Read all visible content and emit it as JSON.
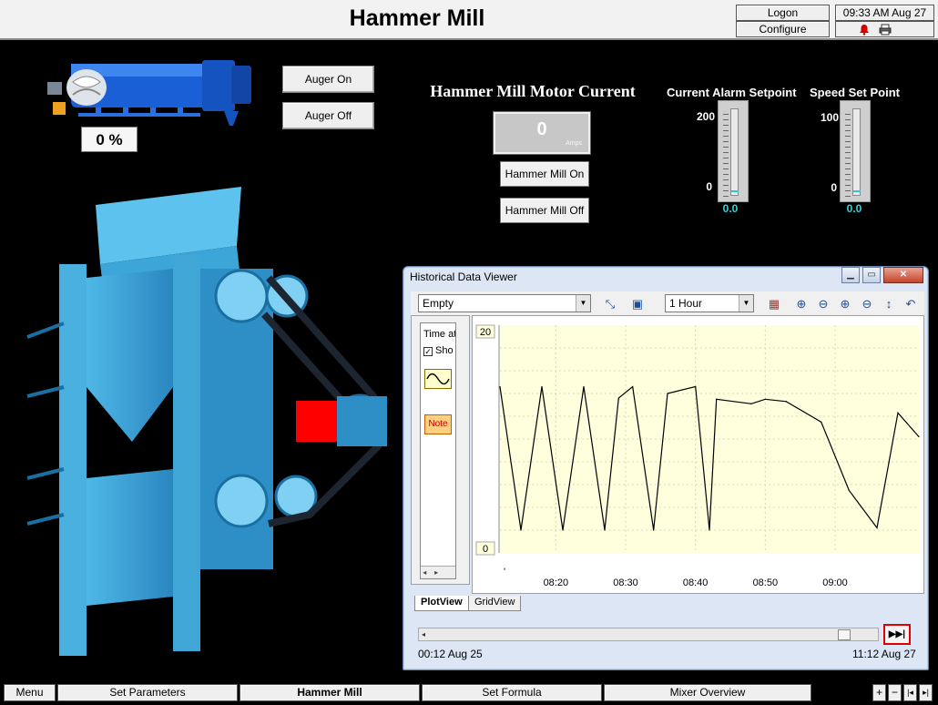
{
  "header": {
    "title": "Hammer Mill",
    "logon_label": "Logon",
    "configure_label": "Configure",
    "datetime": "09:33 AM Aug 27",
    "alarm_icon": "bell-icon",
    "print_icon": "printer-icon"
  },
  "auger": {
    "on_label": "Auger On",
    "off_label": "Auger Off",
    "speed_pct": "0 %"
  },
  "motor": {
    "title": "Hammer Mill Motor Current",
    "value": "0",
    "unit": "Amps",
    "on_label": "Hammer Mill On",
    "off_label": "Hammer Mill Off"
  },
  "alarm_setpoint": {
    "title": "Current Alarm Setpoint",
    "max": "200",
    "min": "0",
    "value": "0.0",
    "level_fraction": 0
  },
  "speed_setpoint": {
    "title": "Speed Set Point",
    "max": "100",
    "min": "0",
    "value": "0.0",
    "level_fraction": 0
  },
  "viewer": {
    "title": "Historical Data Viewer",
    "pen_select": "Empty",
    "duration": "1 Hour",
    "left_time_label": "Time at",
    "left_show_label": "Sho",
    "note_label": "Note",
    "tabs": [
      "PlotView",
      "GridView"
    ],
    "range_start": "00:12  Aug 25",
    "range_end": "11:12  Aug 27",
    "colors": {
      "plot_bg": "#ffffdd",
      "trace": "#000000"
    }
  },
  "chart_data": {
    "type": "line",
    "title": "",
    "xlabel": "",
    "ylabel": "",
    "ylim": [
      0,
      20
    ],
    "xlim_minutes": [
      "08:12",
      "09:12"
    ],
    "x_tick_labels": [
      "08:20",
      "08:30",
      "08:40",
      "08:50",
      "09:00"
    ],
    "y_tick_labels": [
      "20",
      "0"
    ],
    "grid": true,
    "series": [
      {
        "values": [
          [
            "08:12",
            14.6
          ],
          [
            "08:15",
            2.0
          ],
          [
            "08:18",
            14.6
          ],
          [
            "08:21",
            2.0
          ],
          [
            "08:24",
            14.6
          ],
          [
            "08:27",
            2.0
          ],
          [
            "08:29",
            13.6
          ],
          [
            "08:31",
            14.6
          ],
          [
            "08:34",
            2.0
          ],
          [
            "08:36",
            14.0
          ],
          [
            "08:40",
            14.6
          ],
          [
            "08:42",
            2.0
          ],
          [
            "08:43",
            13.5
          ],
          [
            "08:48",
            13.1
          ],
          [
            "08:50",
            13.5
          ],
          [
            "08:53",
            13.3
          ],
          [
            "08:58",
            11.5
          ],
          [
            "09:02",
            5.5
          ],
          [
            "09:06",
            2.2
          ],
          [
            "09:09",
            12.3
          ],
          [
            "09:12",
            10.2
          ]
        ]
      }
    ]
  },
  "nav": {
    "items": [
      "Menu",
      "Set Parameters",
      "Hammer Mill",
      "Set Formula",
      "Mixer Overview"
    ],
    "active": "Hammer Mill",
    "plus": "+",
    "minus": "−",
    "left": "|◂",
    "right": "▸|"
  }
}
